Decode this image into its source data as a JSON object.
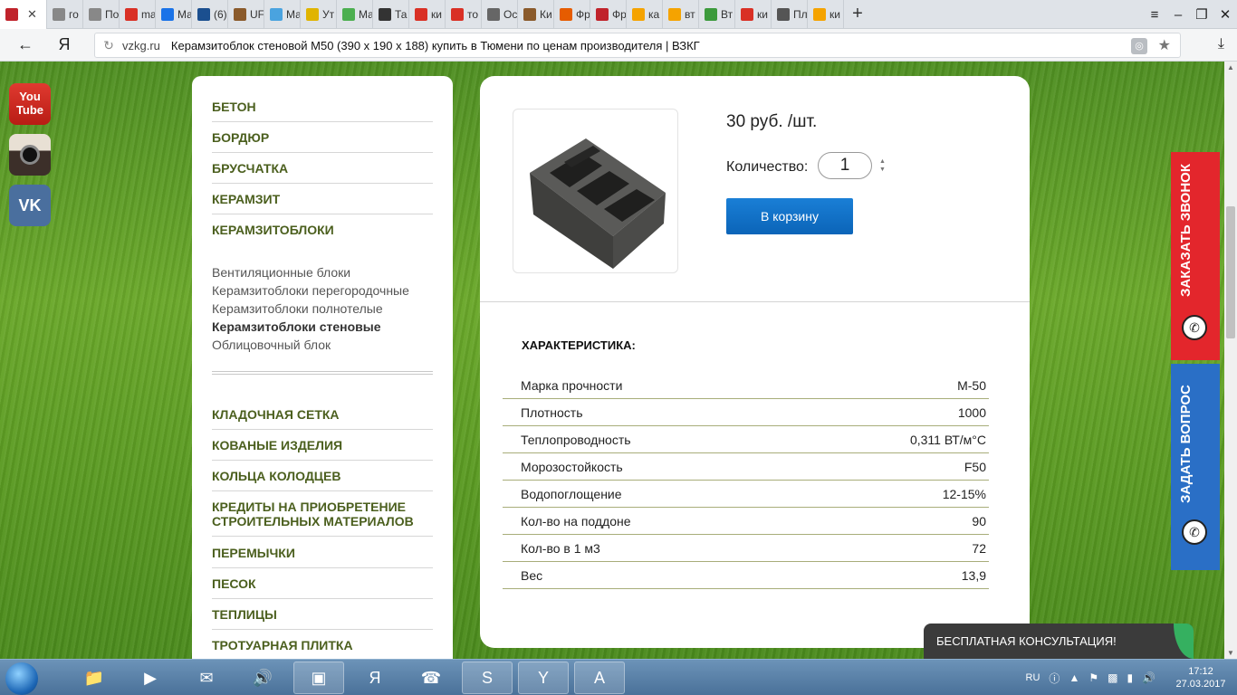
{
  "browser": {
    "tabs": [
      {
        "label": "",
        "color": "#c0232b",
        "active": true
      },
      {
        "label": "го",
        "color": "#888888"
      },
      {
        "label": "По",
        "color": "#888888"
      },
      {
        "label": "ma",
        "color": "#d93025"
      },
      {
        "label": "Ма",
        "color": "#1a73e8"
      },
      {
        "label": "(6)",
        "color": "#1b4f8f"
      },
      {
        "label": "UF",
        "color": "#8a5a2b"
      },
      {
        "label": "Ма",
        "color": "#4aa3df"
      },
      {
        "label": "Ут",
        "color": "#e0b400"
      },
      {
        "label": "Ма",
        "color": "#4caf50"
      },
      {
        "label": "Та",
        "color": "#333333"
      },
      {
        "label": "ки",
        "color": "#d93025"
      },
      {
        "label": "то",
        "color": "#d93025"
      },
      {
        "label": "Ос",
        "color": "#666666"
      },
      {
        "label": "Ки",
        "color": "#8a5a2b"
      },
      {
        "label": "Фр",
        "color": "#e65c00"
      },
      {
        "label": "Фр",
        "color": "#c0232b"
      },
      {
        "label": "ка",
        "color": "#f5a300"
      },
      {
        "label": "вт",
        "color": "#f5a300"
      },
      {
        "label": "Вт",
        "color": "#3c9a3c"
      },
      {
        "label": "ки",
        "color": "#d93025"
      },
      {
        "label": "Пл",
        "color": "#555555"
      },
      {
        "label": "ки",
        "color": "#f5a300"
      }
    ],
    "yandex_logo": "Я",
    "url_domain": "vzkg.ru",
    "page_title": "Керамзитоблок стеновой М50 (390 x 190 x 188) купить в Тюмени по ценам производителя | ВЗКГ"
  },
  "social": {
    "youtube": "You Tube",
    "vk": "VK"
  },
  "sidebar": {
    "categories_top": [
      "БЕТОН",
      "БОРДЮР",
      "БРУСЧАТКА",
      "КЕРАМЗИТ",
      "КЕРАМЗИТОБЛОКИ"
    ],
    "subcategories": [
      {
        "label": "Вентиляционные блоки",
        "current": false
      },
      {
        "label": "Керамзитоблоки перегородочные",
        "current": false
      },
      {
        "label": "Керамзитоблоки полнотелые",
        "current": false
      },
      {
        "label": "Керамзитоблоки стеновые",
        "current": true
      },
      {
        "label": "Облицовочный блок",
        "current": false
      }
    ],
    "categories_bottom": [
      "КЛАДОЧНАЯ СЕТКА",
      "КОВАНЫЕ ИЗДЕЛИЯ",
      "КОЛЬЦА КОЛОДЦЕВ",
      "КРЕДИТЫ НА ПРИОБРЕТЕНИЕ СТРОИТЕЛЬНЫХ МАТЕРИАЛОВ",
      "ПЕРЕМЫЧКИ",
      "ПЕСОК",
      "ТЕПЛИЦЫ",
      "ТРОТУАРНАЯ ПЛИТКА"
    ]
  },
  "product": {
    "price": "30 руб. /шт.",
    "qty_label": "Количество:",
    "qty_value": "1",
    "cart_button": "В корзину",
    "specs_title": "ХАРАКТЕРИСТИКА:",
    "specs": [
      {
        "name": "Марка прочности",
        "value": "М-50"
      },
      {
        "name": "Плотность",
        "value": "1000"
      },
      {
        "name": "Теплопроводность",
        "value": "0,311 ВТ/м°С"
      },
      {
        "name": "Морозостойкость",
        "value": "F50"
      },
      {
        "name": "Водопоглощение",
        "value": "12-15%"
      },
      {
        "name": "Кол-во на поддоне",
        "value": "90"
      },
      {
        "name": "Кол-во в 1 м3",
        "value": "72"
      },
      {
        "name": "Вес",
        "value": "13,9"
      }
    ]
  },
  "side_tabs": {
    "callback": "ЗАКАЗАТЬ ЗВОНОК",
    "question": "ЗАДАТЬ ВОПРОС"
  },
  "consult_bar": "БЕСПЛАТНАЯ КОНСУЛЬТАЦИЯ!",
  "taskbar": {
    "lang": "RU",
    "time": "17:12",
    "date": "27.03.2017"
  }
}
